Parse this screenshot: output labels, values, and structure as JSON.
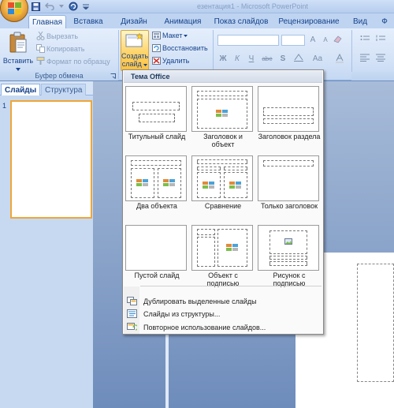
{
  "window": {
    "title": "езентация1 - Microsoft PowerPoint"
  },
  "tabs": [
    {
      "label": "Главная"
    },
    {
      "label": "Вставка"
    },
    {
      "label": "Дизайн"
    },
    {
      "label": "Анимация"
    },
    {
      "label": "Показ слайдов"
    },
    {
      "label": "Рецензирование"
    },
    {
      "label": "Вид"
    },
    {
      "label": "Ф"
    }
  ],
  "clipboard": {
    "paste": "Вставить",
    "cut": "Вырезать",
    "copy": "Копировать",
    "format_painter": "Формат по образцу",
    "group_label": "Буфер обмена"
  },
  "slides_group": {
    "new_slide_line1": "Создать",
    "new_slide_line2": "слайд",
    "layout": "Макет",
    "reset": "Восстановить",
    "delete": "Удалить"
  },
  "font_group": {
    "bold": "Ж",
    "italic": "К",
    "underline": "Ч",
    "strike": "abe",
    "shadow": "S",
    "grow": "A",
    "shrink": "A",
    "change_case": "Aa"
  },
  "pane": {
    "tab_slides": "Слайды",
    "tab_outline": "Структура",
    "slide_number": "1"
  },
  "menu": {
    "header": "Тема Office",
    "layouts": [
      {
        "label": "Титульный слайд"
      },
      {
        "label": "Заголовок и объект"
      },
      {
        "label": "Заголовок раздела"
      },
      {
        "label": "Два объекта"
      },
      {
        "label": "Сравнение"
      },
      {
        "label": "Только заголовок"
      },
      {
        "label": "Пустой слайд"
      },
      {
        "label": "Объект с подписью"
      },
      {
        "label": "Рисунок с подписью"
      }
    ],
    "items": [
      {
        "label": "Дублировать выделенные слайды"
      },
      {
        "label": "Слайды из структуры..."
      },
      {
        "label": "Повторное использование слайдов..."
      }
    ]
  }
}
